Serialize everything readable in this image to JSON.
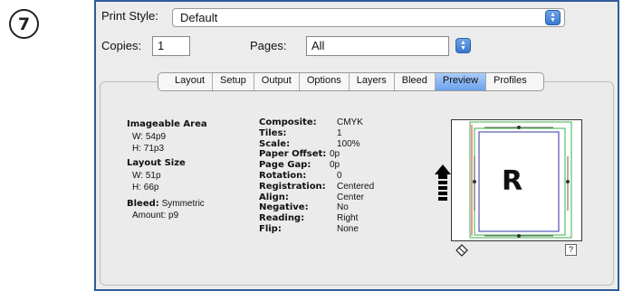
{
  "step_number": "7",
  "print_style": {
    "label": "Print Style:",
    "value": "Default"
  },
  "copies": {
    "label": "Copies:",
    "value": "1"
  },
  "pages": {
    "label": "Pages:",
    "value": "All"
  },
  "tabs": [
    "Layout",
    "Setup",
    "Output",
    "Options",
    "Layers",
    "Bleed",
    "Preview",
    "Profiles"
  ],
  "active_tab": "Preview",
  "imageable_area": {
    "heading": "Imageable Area",
    "w": "W: 54p9",
    "h": "H: 71p3"
  },
  "layout_size": {
    "heading": "Layout Size",
    "w": "W: 51p",
    "h": "H: 66p"
  },
  "bleed": {
    "label": "Bleed:",
    "value": "Symmetric",
    "amount": "Amount: p9"
  },
  "settings": [
    {
      "key": "Composite:",
      "value": "CMYK"
    },
    {
      "key": "Tiles:",
      "value": "1"
    },
    {
      "key": "Scale:",
      "value": "100%"
    },
    {
      "key": "Paper Offset:",
      "value": "0p"
    },
    {
      "key": "Page Gap:",
      "value": "0p"
    },
    {
      "key": "Rotation:",
      "value": "0"
    },
    {
      "key": "Registration:",
      "value": "Centered"
    },
    {
      "key": "Align:",
      "value": "Center"
    },
    {
      "key": "Negative:",
      "value": "No"
    },
    {
      "key": "Reading:",
      "value": "Right"
    },
    {
      "key": "Flip:",
      "value": "None"
    }
  ],
  "preview": {
    "page_letter": "R",
    "help_label": "?"
  },
  "colors": {
    "accent": "#2e5b9a",
    "tab_active": "#6ca2ec",
    "bleed_green": "#3bb34a",
    "margin_red": "#d33",
    "margin_blue": "#33a"
  }
}
